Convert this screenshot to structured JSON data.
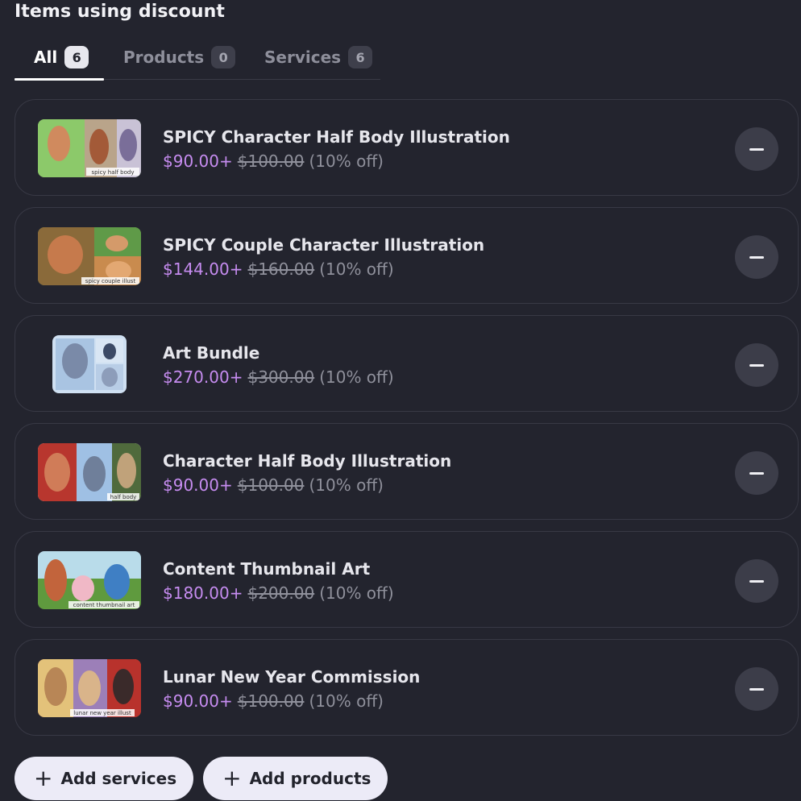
{
  "title": "Items using discount",
  "tabs": [
    {
      "label": "All",
      "count": "6"
    },
    {
      "label": "Products",
      "count": "0"
    },
    {
      "label": "Services",
      "count": "6"
    }
  ],
  "items": [
    {
      "name": "SPICY Character Half Body Illustration",
      "price": "$90.00+",
      "original": "$100.00",
      "off": "(10% off)",
      "thumb_caption": "spicy half body"
    },
    {
      "name": "SPICY Couple Character Illustration",
      "price": "$144.00+",
      "original": "$160.00",
      "off": "(10% off)",
      "thumb_caption": "spicy couple illust"
    },
    {
      "name": "Art Bundle",
      "price": "$270.00+",
      "original": "$300.00",
      "off": "(10% off)",
      "thumb_caption": ""
    },
    {
      "name": "Character Half Body Illustration",
      "price": "$90.00+",
      "original": "$100.00",
      "off": "(10% off)",
      "thumb_caption": "half body"
    },
    {
      "name": "Content Thumbnail Art",
      "price": "$180.00+",
      "original": "$200.00",
      "off": "(10% off)",
      "thumb_caption": "content thumbnail art"
    },
    {
      "name": "Lunar New Year Commission",
      "price": "$90.00+",
      "original": "$100.00",
      "off": "(10% off)",
      "thumb_caption": "lunar new year illust"
    }
  ],
  "actions": {
    "add_services": "Add services",
    "add_products": "Add products",
    "plus_icon": "+"
  },
  "colors": {
    "background": "#23242e",
    "price_accent": "#c68cf0",
    "button_bg": "#ecebf7"
  }
}
